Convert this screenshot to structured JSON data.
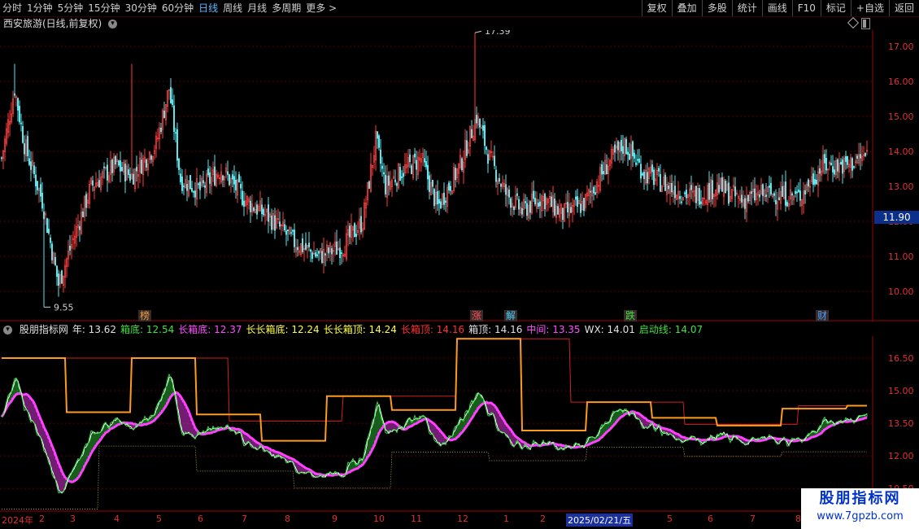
{
  "toolbar": {
    "periods": [
      {
        "label": "分时",
        "active": false
      },
      {
        "label": "1分钟",
        "active": false
      },
      {
        "label": "5分钟",
        "active": false
      },
      {
        "label": "15分钟",
        "active": false
      },
      {
        "label": "30分钟",
        "active": false
      },
      {
        "label": "60分钟",
        "active": false
      },
      {
        "label": "日线",
        "active": true
      },
      {
        "label": "周线",
        "active": false
      },
      {
        "label": "月线",
        "active": false
      },
      {
        "label": "多周期",
        "active": false
      },
      {
        "label": "更多 >",
        "active": false
      }
    ],
    "actions": [
      "复权",
      "叠加",
      "多股",
      "统计",
      "画线",
      "F10",
      "标记",
      "+自选",
      "返回"
    ]
  },
  "main_chart": {
    "title": "西安旅游(日线,前复权)",
    "y_ticks": [
      "17.00",
      "16.00",
      "15.00",
      "14.00",
      "13.00",
      "12.00",
      "11.00",
      "10.00"
    ],
    "current_price": "11.90",
    "high_label": "17.39",
    "low_label": "9.55",
    "events": [
      {
        "label": "榜",
        "color": "#e8a040"
      },
      {
        "label": "涨",
        "color": "#ff5050"
      },
      {
        "label": "解",
        "color": "#40d0ff"
      },
      {
        "label": "跌",
        "color": "#40e040"
      },
      {
        "label": "财",
        "color": "#40a0ff"
      }
    ]
  },
  "indicator": {
    "name": "股朋指标网",
    "values": [
      {
        "label": "年: 13.62",
        "color": "#e0e0e0"
      },
      {
        "label": "箱底: 12.54",
        "color": "#40e040"
      },
      {
        "label": "长箱底: 12.37",
        "color": "#ff50ff"
      },
      {
        "label": "长长箱底: 12.24",
        "color": "#ffff40"
      },
      {
        "label": "长长箱顶: 14.24",
        "color": "#ffff40"
      },
      {
        "label": "长箱顶: 14.16",
        "color": "#ff3030"
      },
      {
        "label": "箱顶: 14.16",
        "color": "#e0e0e0"
      },
      {
        "label": "中间: 13.35",
        "color": "#ff50ff"
      },
      {
        "label": "WX: 14.01",
        "color": "#e0e0e0"
      },
      {
        "label": "启动线: 14.07",
        "color": "#40e040"
      }
    ],
    "y_ticks": [
      "16.50",
      "15.00",
      "13.50",
      "12.00",
      "10.50"
    ]
  },
  "date_axis": {
    "labels": [
      "2024年",
      "2",
      "3",
      "4",
      "5",
      "6",
      "7",
      "8",
      "9",
      "10",
      "11",
      "12",
      "1",
      "2",
      "2025/02/21/五",
      "5",
      "6",
      "7",
      "8"
    ]
  },
  "watermark": {
    "line1": "股朋指标网",
    "line2": "www.7gpzb.com"
  },
  "colors": {
    "up": "#ff3c3c",
    "down": "#54e8f0",
    "grid": "#5a0000",
    "axis": "#a00000"
  }
}
